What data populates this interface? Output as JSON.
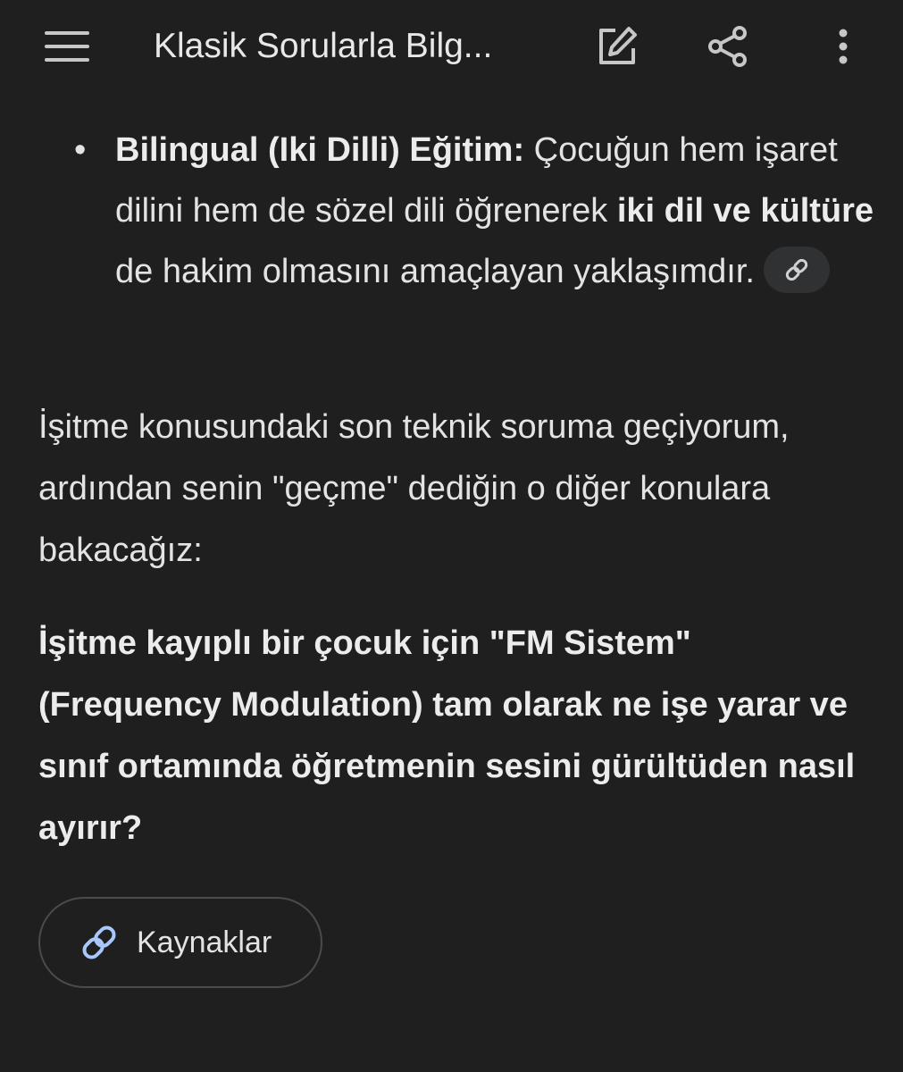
{
  "header": {
    "title": "Klasik Sorularla Bilg..."
  },
  "icons": {
    "menu": "hamburger-menu-icon",
    "edit": "edit-icon",
    "share": "share-icon",
    "more": "more-vert-icon",
    "link": "link-icon"
  },
  "bullet": {
    "bold_lead": "Bilingual (Iki Dilli) Eğitim:",
    "text_1": " Çocuğun hem işaret dilini hem de sözel dili öğrenerek ",
    "bold_mid": "iki dil ve kültüre",
    "text_2": " de hakim olmasını amaçlayan yaklaşımdır."
  },
  "paragraph": "İşitme konusundaki son teknik soruma geçiyorum, ardından senin \"geçme\" dediğin o diğer konulara bakacağız:",
  "question": "İşitme kayıplı bir çocuk için \"FM Sistem\" (Frequency Modulation) tam olarak ne işe yarar ve sınıf ortamında öğretmenin sesini gürültüden nasıl ayırır?",
  "sources_button": {
    "label": "Kaynaklar"
  },
  "colors": {
    "background": "#1f1f20",
    "text": "#e3e3e3",
    "link_accent": "#a8c7fa",
    "chip_bg": "#303133"
  }
}
